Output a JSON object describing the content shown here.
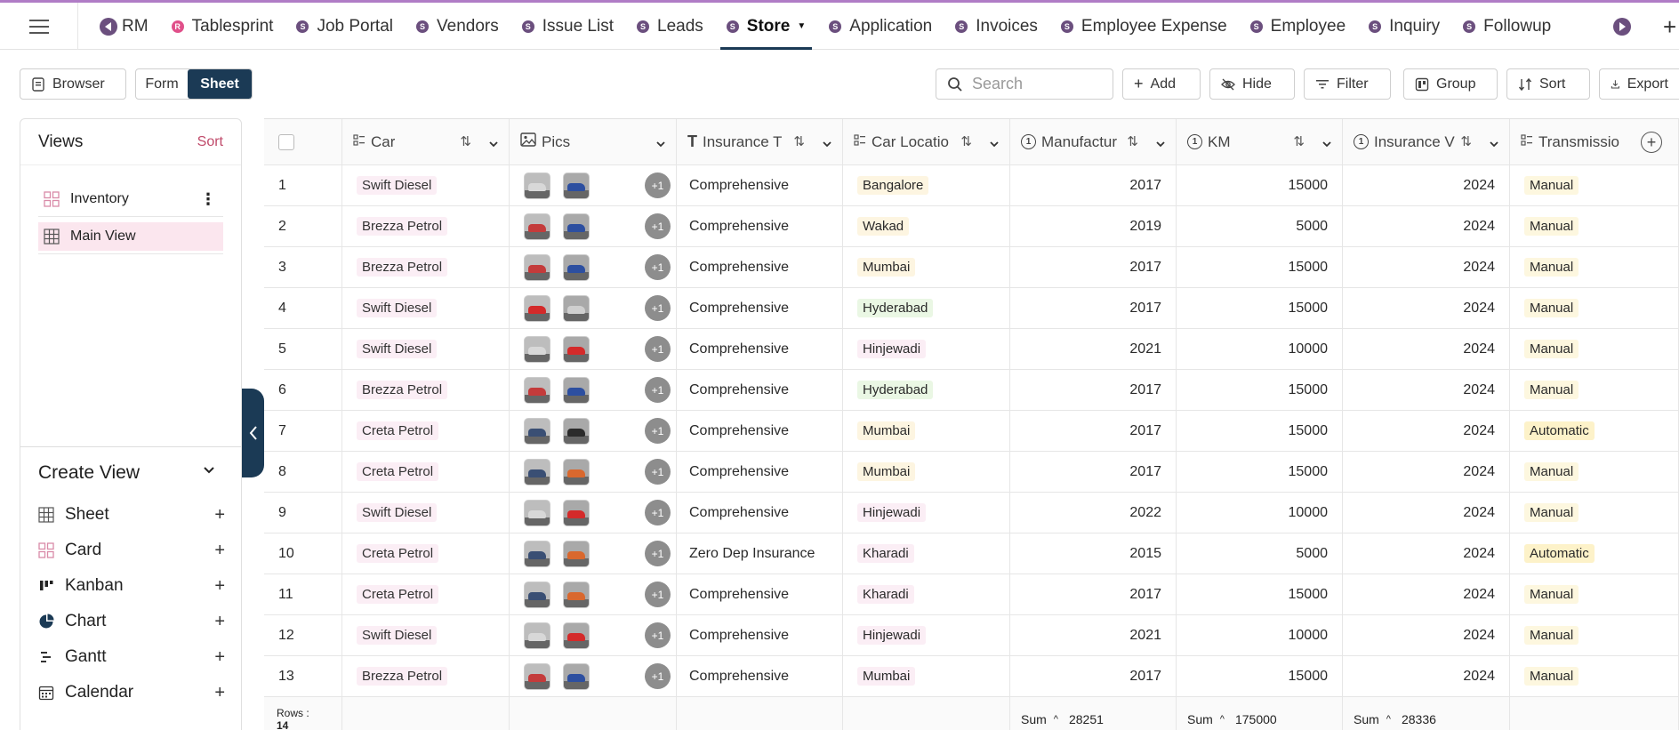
{
  "topbar": {
    "tabs": [
      {
        "label": "RM",
        "icon": "S"
      },
      {
        "label": "Tablesprint",
        "icon": "R"
      },
      {
        "label": "Job Portal",
        "icon": "S"
      },
      {
        "label": "Vendors",
        "icon": "S"
      },
      {
        "label": "Issue List",
        "icon": "S"
      },
      {
        "label": "Leads",
        "icon": "S"
      },
      {
        "label": "Store",
        "icon": "S"
      },
      {
        "label": "Application",
        "icon": "S"
      },
      {
        "label": "Invoices",
        "icon": "S"
      },
      {
        "label": "Employee Expense",
        "icon": "S"
      },
      {
        "label": "Employee",
        "icon": "S"
      },
      {
        "label": "Inquiry",
        "icon": "S"
      },
      {
        "label": "Followup",
        "icon": "S"
      }
    ],
    "active_tab": "Store",
    "plus": "+"
  },
  "toolbar": {
    "browser_label": "Browser",
    "form_label": "Form",
    "sheet_label": "Sheet",
    "search_placeholder": "Search",
    "add_label": "Add",
    "hide_label": "Hide",
    "filter_label": "Filter",
    "group_label": "Group",
    "sort_label": "Sort",
    "export_label": "Export"
  },
  "views_panel": {
    "title": "Views",
    "sort_label": "Sort",
    "items": [
      {
        "label": "Inventory",
        "icon": "card-icon"
      },
      {
        "label": "Main View",
        "icon": "grid-icon"
      }
    ],
    "create_title": "Create View",
    "create_items": [
      {
        "label": "Sheet",
        "icon": "grid-icon"
      },
      {
        "label": "Card",
        "icon": "card-icon"
      },
      {
        "label": "Kanban",
        "icon": "kanban-icon"
      },
      {
        "label": "Chart",
        "icon": "pie-icon"
      },
      {
        "label": "Gantt",
        "icon": "gantt-icon"
      },
      {
        "label": "Calendar",
        "icon": "calendar-icon"
      }
    ],
    "add_symbol": "+"
  },
  "grid": {
    "columns": [
      "Car",
      "Pics",
      "Insurance T",
      "Car Locatio",
      "Manufactur",
      "KM",
      "Insurance V",
      "Transmissio"
    ],
    "rows": [
      {
        "n": "1",
        "car": "Swift Diesel",
        "pics": [
          "#d8d8d8",
          "#2d4fa0"
        ],
        "more": "+1",
        "ins": "Comprehensive",
        "loc": "Bangalore",
        "loc_tone": "a",
        "mfg": "2017",
        "km": "15000",
        "insv": "2024",
        "trans": "Manual"
      },
      {
        "n": "2",
        "car": "Brezza Petrol",
        "pics": [
          "#c43b3b",
          "#2d4fa0"
        ],
        "more": "+1",
        "ins": "Comprehensive",
        "loc": "Wakad",
        "loc_tone": "a",
        "mfg": "2019",
        "km": "5000",
        "insv": "2024",
        "trans": "Manual"
      },
      {
        "n": "3",
        "car": "Brezza Petrol",
        "pics": [
          "#c43b3b",
          "#2d4fa0"
        ],
        "more": "+1",
        "ins": "Comprehensive",
        "loc": "Mumbai",
        "loc_tone": "a",
        "mfg": "2017",
        "km": "15000",
        "insv": "2024",
        "trans": "Manual"
      },
      {
        "n": "4",
        "car": "Swift Diesel",
        "pics": [
          "#d42a2a",
          "#cfcfcf"
        ],
        "more": "+1",
        "ins": "Comprehensive",
        "loc": "Hyderabad",
        "loc_tone": "b",
        "mfg": "2017",
        "km": "15000",
        "insv": "2024",
        "trans": "Manual"
      },
      {
        "n": "5",
        "car": "Swift Diesel",
        "pics": [
          "#d8d8d8",
          "#d42a2a"
        ],
        "more": "+1",
        "ins": "Comprehensive",
        "loc": "Hinjewadi",
        "loc_tone": "c",
        "mfg": "2021",
        "km": "10000",
        "insv": "2024",
        "trans": "Manual"
      },
      {
        "n": "6",
        "car": "Brezza Petrol",
        "pics": [
          "#c43b3b",
          "#2d4fa0"
        ],
        "more": "+1",
        "ins": "Comprehensive",
        "loc": "Hyderabad",
        "loc_tone": "b",
        "mfg": "2017",
        "km": "15000",
        "insv": "2024",
        "trans": "Manual"
      },
      {
        "n": "7",
        "car": "Creta Petrol",
        "pics": [
          "#3a4f74",
          "#2b2b2b"
        ],
        "more": "+1",
        "ins": "Comprehensive",
        "loc": "Mumbai",
        "loc_tone": "a",
        "mfg": "2017",
        "km": "15000",
        "insv": "2024",
        "trans": "Automatic"
      },
      {
        "n": "8",
        "car": "Creta Petrol",
        "pics": [
          "#3a4f74",
          "#d9682e"
        ],
        "more": "+1",
        "ins": "Comprehensive",
        "loc": "Mumbai",
        "loc_tone": "a",
        "mfg": "2017",
        "km": "15000",
        "insv": "2024",
        "trans": "Manual"
      },
      {
        "n": "9",
        "car": "Swift Diesel",
        "pics": [
          "#d8d8d8",
          "#d42a2a"
        ],
        "more": "+1",
        "ins": "Comprehensive",
        "loc": "Hinjewadi",
        "loc_tone": "c",
        "mfg": "2022",
        "km": "10000",
        "insv": "2024",
        "trans": "Manual"
      },
      {
        "n": "10",
        "car": "Creta Petrol",
        "pics": [
          "#3a4f74",
          "#d9682e"
        ],
        "more": "+1",
        "ins": "Zero Dep Insurance",
        "loc": "Kharadi",
        "loc_tone": "c",
        "mfg": "2015",
        "km": "5000",
        "insv": "2024",
        "trans": "Automatic"
      },
      {
        "n": "11",
        "car": "Creta Petrol",
        "pics": [
          "#3a4f74",
          "#d9682e"
        ],
        "more": "+1",
        "ins": "Comprehensive",
        "loc": "Kharadi",
        "loc_tone": "c",
        "mfg": "2017",
        "km": "15000",
        "insv": "2024",
        "trans": "Manual"
      },
      {
        "n": "12",
        "car": "Swift Diesel",
        "pics": [
          "#d8d8d8",
          "#d42a2a"
        ],
        "more": "+1",
        "ins": "Comprehensive",
        "loc": "Hinjewadi",
        "loc_tone": "c",
        "mfg": "2021",
        "km": "10000",
        "insv": "2024",
        "trans": "Manual"
      },
      {
        "n": "13",
        "car": "Brezza Petrol",
        "pics": [
          "#c43b3b",
          "#2d4fa0"
        ],
        "more": "+1",
        "ins": "Comprehensive",
        "loc": "Mumbai",
        "loc_tone": "c",
        "mfg": "2017",
        "km": "15000",
        "insv": "2024",
        "trans": "Manual"
      }
    ],
    "footer": {
      "rows_label": "Rows :",
      "rows_count": "14",
      "sum_label": "Sum",
      "mfg_sum": "28251",
      "km_sum": "175000",
      "insv_sum": "28336"
    }
  }
}
